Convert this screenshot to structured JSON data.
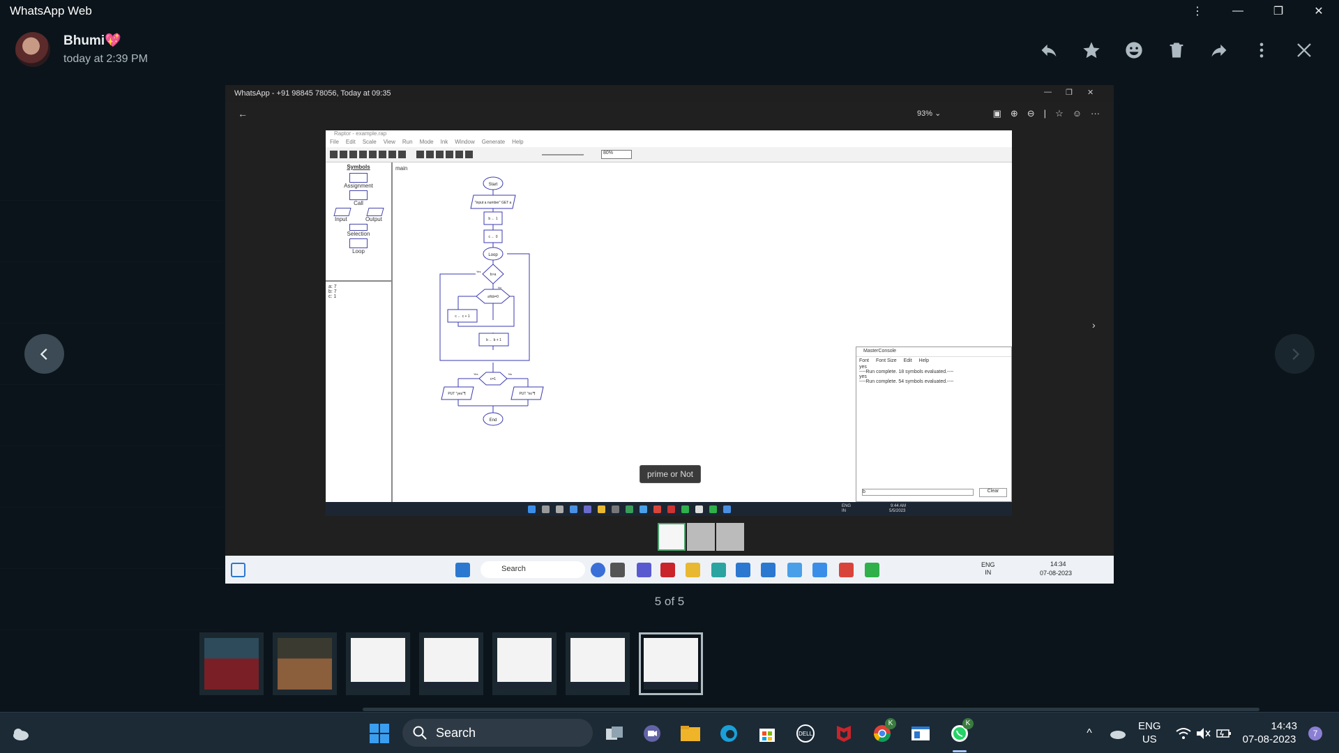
{
  "app": {
    "title": "WhatsApp Web"
  },
  "window_controls": [
    "more-vertical",
    "minimize",
    "maximize",
    "close"
  ],
  "header": {
    "sender_name": "Bhumi💖",
    "timestamp": "today at 2:39 PM",
    "actions": [
      "reply",
      "star",
      "react",
      "delete",
      "forward",
      "more",
      "close"
    ]
  },
  "viewer": {
    "counter": "5 of 5"
  },
  "photo": {
    "window_title": "WhatsApp - +91 98845 78056, Today at 09:35",
    "zoom": "93%",
    "tooltip": "prime or Not",
    "raptor": {
      "title": "Raptor - example.rap",
      "menu": [
        "File",
        "Edit",
        "Scale",
        "View",
        "Run",
        "Mode",
        "Ink",
        "Window",
        "Generate",
        "Help"
      ],
      "zoom": "80%",
      "symbols_label": "Symbols",
      "symbols": [
        "Assignment",
        "Call",
        "Input",
        "Output",
        "Selection",
        "Loop"
      ],
      "variables": [
        "a: 7",
        "b: 7",
        "c: 1"
      ],
      "tab": "main",
      "flow": {
        "start": "Start",
        "input": "\"input a number\" GET a",
        "assign1": "b ← 1",
        "assign2": "c ← 0",
        "loop": "Loop",
        "cond1": "b>a",
        "cond2": "a%b=0",
        "assign3": "c ← c + 1",
        "assign4": "b ← b + 1",
        "cond3": "c=1",
        "yes_label": "Yes",
        "no_label": "No",
        "out_yes": "PUT \"yes\"¶",
        "out_no": "PUT \"no\"¶",
        "end": "End"
      },
      "console": {
        "title": "MasterConsole",
        "menu": [
          "Font",
          "Font Size",
          "Edit",
          "Help"
        ],
        "lines": [
          "yes",
          "----Run complete.  18 symbols evaluated.----",
          "yes",
          "----Run complete.  54 symbols evaluated.----"
        ],
        "input_value": "b",
        "clear_label": "Clear"
      },
      "taskbar": {
        "lang": "ENG\nIN",
        "time": "9:44 AM",
        "date": "5/5/2023"
      }
    },
    "win_taskbar": {
      "search_placeholder": "Search",
      "lang": "ENG\nIN",
      "time": "14:34",
      "date": "07-08-2023"
    }
  },
  "thumbnails": [
    "photo-person-1",
    "photo-person-2",
    "screenshot-1",
    "screenshot-2",
    "screenshot-3",
    "screenshot-4",
    "screenshot-5-selected"
  ],
  "taskbar": {
    "search_placeholder": "Search",
    "lang": "ENG",
    "region": "US",
    "time": "14:43",
    "date": "07-08-2023",
    "notification_count": "7",
    "badge_chrome": "K",
    "badge_whatsapp": "K"
  },
  "colors": {
    "bg": "#0b141a",
    "taskbar": "#1c2a36",
    "accent": "#00a884"
  }
}
